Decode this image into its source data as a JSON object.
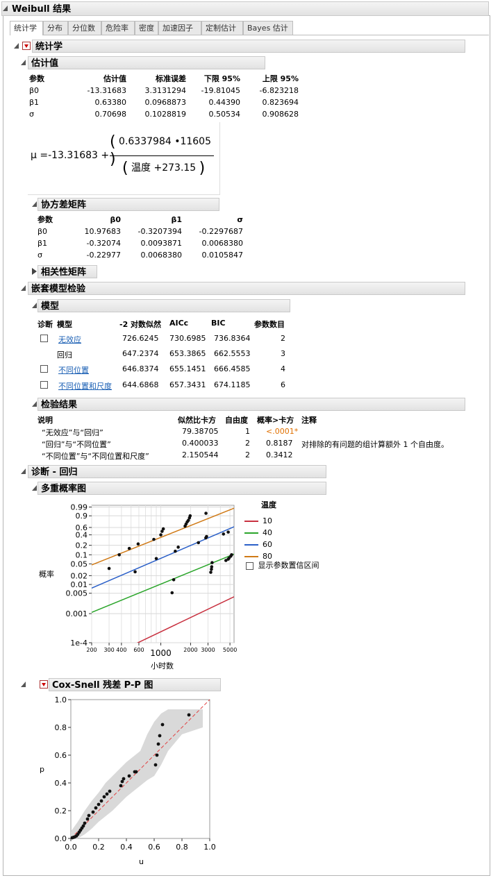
{
  "window": {
    "title": "Weibull 结果"
  },
  "tabs": [
    {
      "label": "统计学",
      "active": true
    },
    {
      "label": "分布"
    },
    {
      "label": "分位数"
    },
    {
      "label": "危险率"
    },
    {
      "label": "密度"
    },
    {
      "label": "加速因子"
    },
    {
      "label": "定制估计"
    },
    {
      "label": "Bayes 估计"
    }
  ],
  "stats": {
    "title": "统计学",
    "estimates": {
      "title": "估计值",
      "headers": [
        "参数",
        "估计值",
        "标准误差",
        "下限 95%",
        "上限 95%"
      ],
      "rows": [
        [
          "β0",
          "-13.31683",
          "3.3131294",
          "-19.81045",
          "-6.823218"
        ],
        [
          "β1",
          "0.63380",
          "0.0968873",
          "0.44390",
          "0.823694"
        ],
        [
          "σ",
          "0.70698",
          "0.1028819",
          "0.50534",
          "0.908628"
        ]
      ]
    },
    "formula": {
      "lhs": "μ =",
      "intercept": "-13.31683 +",
      "numerator": "0.6337984 •11605",
      "den_var": "温度",
      "den_const": "+273.15"
    },
    "cov": {
      "title": "协方差矩阵",
      "headers": [
        "参数",
        "β0",
        "β1",
        "σ"
      ],
      "rows": [
        [
          "β0",
          "10.97683",
          "-0.3207394",
          "-0.2297687"
        ],
        [
          "β1",
          "-0.32074",
          "0.0093871",
          "0.0068380"
        ],
        [
          "σ",
          "-0.22977",
          "0.0068380",
          "0.0105847"
        ]
      ]
    },
    "corr": {
      "title": "相关性矩阵"
    }
  },
  "nested": {
    "title": "嵌套模型检验",
    "model": {
      "title": "模型",
      "headers": [
        "诊断",
        "模型",
        "-2 对数似然",
        "AICc",
        "BIC",
        "参数数目"
      ],
      "rows": [
        {
          "check": true,
          "name": "无效应",
          "link": true,
          "ll": "726.6245",
          "aicc": "730.6985",
          "bic": "736.8364",
          "k": "2"
        },
        {
          "check": false,
          "name": "回归",
          "link": false,
          "ll": "647.2374",
          "aicc": "653.3865",
          "bic": "662.5553",
          "k": "3"
        },
        {
          "check": true,
          "name": "不同位置",
          "link": true,
          "ll": "646.8374",
          "aicc": "655.1451",
          "bic": "666.4585",
          "k": "4"
        },
        {
          "check": true,
          "name": "不同位置和尺度",
          "link": true,
          "ll": "644.6868",
          "aicc": "657.3431",
          "bic": "674.1185",
          "k": "6"
        }
      ]
    },
    "tests": {
      "title": "检验结果",
      "headers": [
        "说明",
        "似然比卡方",
        "自由度",
        "概率>卡方",
        "注释"
      ],
      "rows": [
        {
          "desc": "“无效应”与“回归”",
          "chi": "79.38705",
          "df": "1",
          "p": "<.0001*",
          "sig": true,
          "note": ""
        },
        {
          "desc": "“回归”与“不同位置”",
          "chi": "0.400033",
          "df": "2",
          "p": "0.8187",
          "sig": false,
          "note": "对排除的有问题的组计算额外 1 个自由度。"
        },
        {
          "desc": "“不同位置”与“不同位置和尺度”",
          "chi": "2.150544",
          "df": "2",
          "p": "0.3412",
          "sig": false,
          "note": ""
        }
      ]
    }
  },
  "diag": {
    "title": "诊断 - 回归",
    "multi": {
      "title": "多重概率图",
      "ylabel": "概率",
      "xlabel": "小时数",
      "legend_title": "温度",
      "show_ci_label": "显示参数置信区间",
      "legend": [
        {
          "label": "10",
          "color": "#c8303f"
        },
        {
          "label": "40",
          "color": "#2aa52a"
        },
        {
          "label": "60",
          "color": "#2a5fc8"
        },
        {
          "label": "80",
          "color": "#d07a16"
        }
      ]
    },
    "coxsnell": {
      "title": "Cox-Snell 残差 P-P 图",
      "xlabel": "u",
      "ylabel": "p"
    }
  },
  "chart_data": [
    {
      "type": "scatter",
      "title": "多重概率图",
      "xlabel": "小时数",
      "ylabel": "概率",
      "xscale": "log",
      "yscale": "weibull-probability",
      "xlim": [
        200,
        5500
      ],
      "x_ticks": [
        "200",
        "300",
        "400",
        "600",
        "1000",
        "2000",
        "3000",
        "5000"
      ],
      "y_ticks": [
        "1e-4",
        "0.001",
        "0.005",
        "0.01",
        "0.02",
        "0.05",
        "0.1",
        "0.2",
        "0.4",
        "0.6",
        "0.9",
        "0.99"
      ],
      "grid": true,
      "legend_title": "温度",
      "series": [
        {
          "name": "10",
          "line": [
            [
              550,
              9e-05
            ],
            [
              5500,
              0.0038
            ]
          ],
          "points": []
        },
        {
          "name": "40",
          "line": [
            [
              200,
              0.0011
            ],
            [
              5500,
              0.105
            ]
          ],
          "points": [
            [
              1300,
              0.0052
            ],
            [
              1350,
              0.0145
            ],
            [
              3200,
              0.026
            ],
            [
              3250,
              0.033
            ],
            [
              3270,
              0.04
            ],
            [
              3300,
              0.055
            ],
            [
              4550,
              0.065
            ],
            [
              4800,
              0.072
            ],
            [
              4900,
              0.078
            ],
            [
              5100,
              0.09
            ],
            [
              5200,
              0.1
            ]
          ]
        },
        {
          "name": "60",
          "line": [
            [
              200,
              0.0075
            ],
            [
              5500,
              0.62
            ]
          ],
          "points": [
            [
              550,
              0.027
            ],
            [
              900,
              0.075
            ],
            [
              1400,
              0.13
            ],
            [
              1500,
              0.175
            ],
            [
              2400,
              0.24
            ],
            [
              2850,
              0.33
            ],
            [
              2900,
              0.36
            ],
            [
              4300,
              0.42
            ],
            [
              4800,
              0.47
            ]
          ]
        },
        {
          "name": "80",
          "line": [
            [
              200,
              0.046
            ],
            [
              5500,
              0.985
            ]
          ],
          "points": [
            [
              300,
              0.035
            ],
            [
              380,
              0.1
            ],
            [
              480,
              0.16
            ],
            [
              590,
              0.22
            ],
            [
              850,
              0.3
            ],
            [
              1000,
              0.4
            ],
            [
              1030,
              0.49
            ],
            [
              1060,
              0.56
            ],
            [
              1760,
              0.64
            ],
            [
              1800,
              0.7
            ],
            [
              1850,
              0.76
            ],
            [
              1900,
              0.8
            ],
            [
              1950,
              0.86
            ],
            [
              1980,
              0.9
            ],
            [
              2860,
              0.94
            ]
          ]
        }
      ]
    },
    {
      "type": "scatter",
      "title": "Cox-Snell 残差 P-P 图",
      "xlabel": "u",
      "ylabel": "p",
      "xlim": [
        0,
        1
      ],
      "ylim": [
        0,
        1
      ],
      "x_ticks": [
        "0.0",
        "0.2",
        "0.4",
        "0.6",
        "0.8",
        "1.0"
      ],
      "y_ticks": [
        "0.0",
        "0.2",
        "0.4",
        "0.6",
        "0.8",
        "1.0"
      ],
      "reference_line": "y=x",
      "points": [
        [
          0.01,
          0.005
        ],
        [
          0.02,
          0.008
        ],
        [
          0.03,
          0.012
        ],
        [
          0.04,
          0.018
        ],
        [
          0.05,
          0.03
        ],
        [
          0.06,
          0.045
        ],
        [
          0.07,
          0.06
        ],
        [
          0.08,
          0.075
        ],
        [
          0.09,
          0.09
        ],
        [
          0.1,
          0.11
        ],
        [
          0.12,
          0.14
        ],
        [
          0.13,
          0.165
        ],
        [
          0.16,
          0.19
        ],
        [
          0.18,
          0.22
        ],
        [
          0.2,
          0.245
        ],
        [
          0.22,
          0.27
        ],
        [
          0.24,
          0.3
        ],
        [
          0.26,
          0.32
        ],
        [
          0.28,
          0.34
        ],
        [
          0.36,
          0.38
        ],
        [
          0.37,
          0.41
        ],
        [
          0.38,
          0.43
        ],
        [
          0.42,
          0.45
        ],
        [
          0.46,
          0.48
        ],
        [
          0.47,
          0.48
        ],
        [
          0.61,
          0.53
        ],
        [
          0.62,
          0.6
        ],
        [
          0.63,
          0.68
        ],
        [
          0.64,
          0.74
        ],
        [
          0.66,
          0.82
        ],
        [
          0.85,
          0.89
        ]
      ],
      "ci_band": [
        [
          0.0,
          0.0,
          0.05
        ],
        [
          0.05,
          0.0,
          0.12
        ],
        [
          0.1,
          0.03,
          0.2
        ],
        [
          0.15,
          0.07,
          0.27
        ],
        [
          0.2,
          0.12,
          0.33
        ],
        [
          0.25,
          0.16,
          0.4
        ],
        [
          0.3,
          0.2,
          0.45
        ],
        [
          0.35,
          0.25,
          0.5
        ],
        [
          0.4,
          0.3,
          0.55
        ],
        [
          0.5,
          0.38,
          0.63
        ],
        [
          0.55,
          0.42,
          0.75
        ],
        [
          0.6,
          0.45,
          0.84
        ],
        [
          0.65,
          0.53,
          0.9
        ],
        [
          0.7,
          0.63,
          0.93
        ],
        [
          0.8,
          0.75,
          0.93
        ],
        [
          0.95,
          0.8,
          0.93
        ]
      ]
    }
  ]
}
